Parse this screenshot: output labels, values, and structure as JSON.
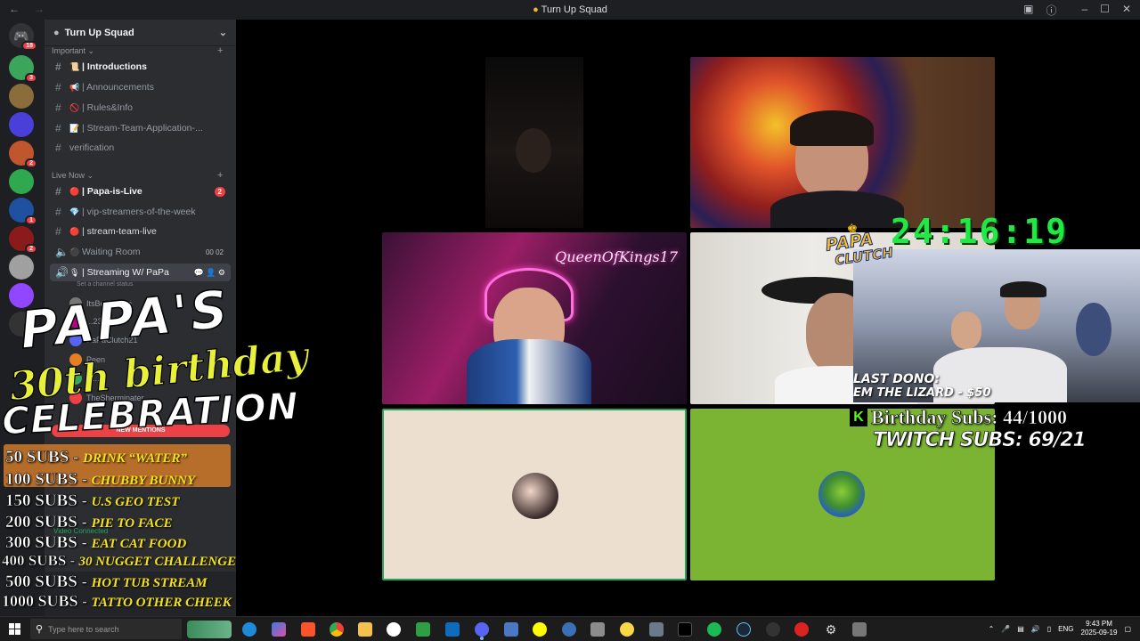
{
  "window": {
    "title": "Turn Up Squad",
    "back_icon": "arrow-left-icon",
    "forward_icon": "arrow-right-icon"
  },
  "guild": {
    "name": "Turn Up Squad"
  },
  "categories": {
    "important": "Important",
    "live_now": "Live Now"
  },
  "channels": [
    {
      "name": "| Introductions",
      "emoji": "📜"
    },
    {
      "name": "| Announcements",
      "emoji": "📢"
    },
    {
      "name": "| Rules&Info",
      "emoji": "🚫"
    },
    {
      "name": "| Stream-Team-Application-...",
      "emoji": "📝"
    },
    {
      "name": "verification",
      "emoji": ""
    },
    {
      "name": "| Papa-is-Live",
      "emoji": "🔴",
      "count": "2"
    },
    {
      "name": "| vip-streamers-of-the-week",
      "emoji": "💎"
    },
    {
      "name": "| stream-team-live",
      "emoji": "🔴"
    },
    {
      "name": "Waiting Room",
      "emoji": "⚫",
      "meta_a": "00",
      "meta_b": "02"
    },
    {
      "name": "| Streaming W/ PaPa",
      "emoji": "🎙"
    }
  ],
  "voice": {
    "status_placeholder": "Set a channel status",
    "users": [
      "ItsBeckDude",
      "...23",
      "PaPaClutch21",
      "Peen",
      "Q...",
      "TheSherminater"
    ]
  },
  "server_badges": [
    "18",
    "3",
    "2",
    "2",
    "2",
    "1",
    "1"
  ],
  "overlay": {
    "line1": "PAPA'S",
    "line2": "30th birthday",
    "line3": "CELEBRATION",
    "new_mentions": "NEW MENTIONS",
    "video_connected": "Video Connected",
    "goals": [
      {
        "subs": "50 SUBS",
        "task": "DRINK “WATER”"
      },
      {
        "subs": "100 SUBS",
        "task": "CHUBBY BUNNY"
      },
      {
        "subs": "150 SUBS",
        "task": "U.S GEO TEST"
      },
      {
        "subs": "200 SUBS",
        "task": "PIE TO FACE"
      },
      {
        "subs": "300 SUBS",
        "task": "EAT CAT FOOD"
      },
      {
        "subs": "400 SUBS",
        "task": "30 NUGGET CHALLENGE"
      },
      {
        "subs": "500 SUBS",
        "task": "HOT TUB STREAM"
      },
      {
        "subs": "1000 SUBS",
        "task": "TATTO OTHER CHEEK"
      }
    ],
    "timer": "24:16:19",
    "logo_top": "PAPA",
    "logo_bottom": "CLUTCH",
    "last_dono_label": "LAST DONO:",
    "last_dono_value": "EM THE LIZARD - $50",
    "birthday_subs": "Birthday Subs: 44/1000",
    "twitch_subs": "TWITCH SUBS: 69/21",
    "kick_badge": "K",
    "user_label": "PaPaClutch21"
  },
  "tiles": {
    "queen_label": "QueenOfKings17"
  },
  "taskbar": {
    "search_text": "Type here to search",
    "lang": "ENG",
    "time": "9:43 PM",
    "date": "2025-09-19"
  },
  "colors": {
    "discord_dark": "#1e1f22",
    "sidebar": "#2b2d31",
    "green_timer": "#22e845",
    "goal_yellow": "#f5e21b",
    "tile_green": "#7ab432",
    "tile_beige": "#ecdfd0"
  }
}
